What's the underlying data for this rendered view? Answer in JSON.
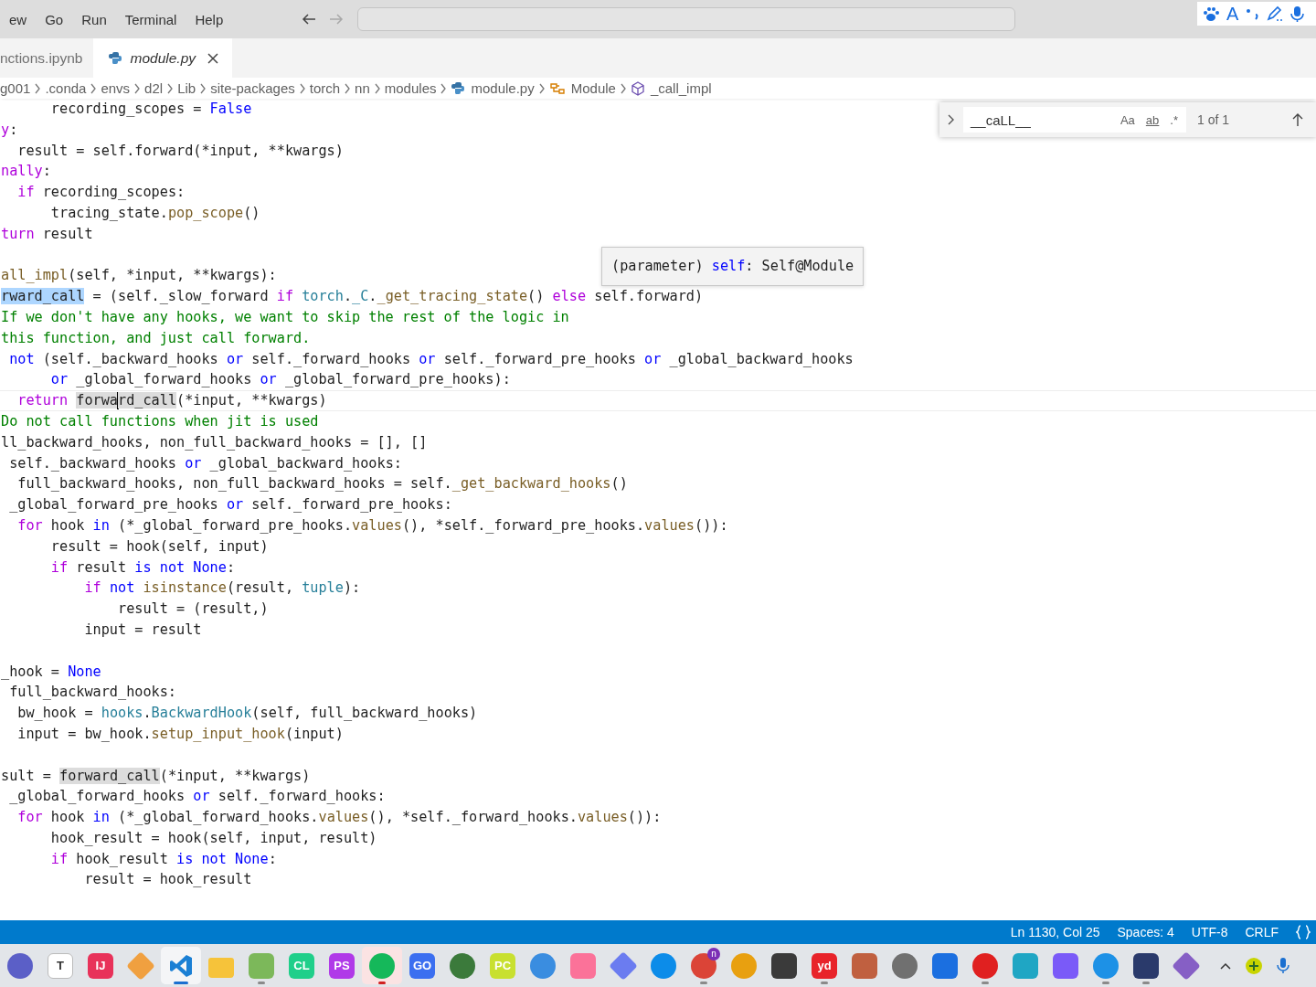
{
  "menu": [
    "ew",
    "Go",
    "Run",
    "Terminal",
    "Help"
  ],
  "navigation": {
    "back_disabled": false,
    "forward_disabled": true
  },
  "ime_toolbar": {
    "mode": "A"
  },
  "tabs": [
    {
      "label": "nctions.ipynb",
      "selected": false,
      "preview": false
    },
    {
      "label": "module.py",
      "selected": true,
      "preview": true
    }
  ],
  "breadcrumbs": [
    {
      "label": "g001",
      "kind": "folder"
    },
    {
      "label": ".conda",
      "kind": "folder"
    },
    {
      "label": "envs",
      "kind": "folder"
    },
    {
      "label": "d2l",
      "kind": "folder"
    },
    {
      "label": "Lib",
      "kind": "folder"
    },
    {
      "label": "site-packages",
      "kind": "folder"
    },
    {
      "label": "torch",
      "kind": "folder"
    },
    {
      "label": "nn",
      "kind": "folder"
    },
    {
      "label": "modules",
      "kind": "folder"
    },
    {
      "label": "module.py",
      "kind": "file"
    },
    {
      "label": "Module",
      "kind": "class"
    },
    {
      "label": "_call_impl",
      "kind": "method"
    }
  ],
  "editor": {
    "lines": [
      {
        "kind": "code",
        "current": false,
        "segments": [
          {
            "kind": "plain",
            "text": "      recording_scopes = "
          },
          {
            "kind": "operator",
            "text": "False"
          }
        ]
      },
      {
        "kind": "code",
        "current": false,
        "segments": [
          {
            "kind": "keyword",
            "text": "y"
          },
          {
            "kind": "plain",
            "text": ":"
          }
        ]
      },
      {
        "kind": "code",
        "current": false,
        "segments": [
          {
            "kind": "plain",
            "text": "  result = self.forward(*input, **kwargs)"
          }
        ]
      },
      {
        "kind": "code",
        "current": false,
        "segments": [
          {
            "kind": "keyword",
            "text": "nally"
          },
          {
            "kind": "plain",
            "text": ":"
          }
        ]
      },
      {
        "kind": "code",
        "current": false,
        "segments": [
          {
            "kind": "keyword",
            "text": "  if"
          },
          {
            "kind": "plain",
            "text": " recording_scopes:"
          }
        ]
      },
      {
        "kind": "code",
        "current": false,
        "segments": [
          {
            "kind": "plain",
            "text": "      tracing_state."
          },
          {
            "kind": "function",
            "text": "pop_scope"
          },
          {
            "kind": "plain",
            "text": "()"
          }
        ]
      },
      {
        "kind": "code",
        "current": false,
        "segments": [
          {
            "kind": "keyword",
            "text": "turn"
          },
          {
            "kind": "plain",
            "text": " result"
          }
        ]
      },
      {
        "kind": "blank"
      },
      {
        "kind": "code",
        "current": false,
        "segments": [
          {
            "kind": "function",
            "text": "all_impl"
          },
          {
            "kind": "plain",
            "text": "(self, *input, **kwargs):"
          }
        ]
      },
      {
        "kind": "code",
        "current": false,
        "segments": [
          {
            "kind": "selection",
            "text": "rward_call"
          },
          {
            "kind": "plain",
            "text": " = (self._slow_forward "
          },
          {
            "kind": "keyword",
            "text": "if "
          },
          {
            "kind": "type",
            "text": "torch"
          },
          {
            "kind": "plain",
            "text": "."
          },
          {
            "kind": "type",
            "text": "_C"
          },
          {
            "kind": "plain",
            "text": "."
          },
          {
            "kind": "function",
            "text": "_get_tracing_state"
          },
          {
            "kind": "plain",
            "text": "() "
          },
          {
            "kind": "keyword",
            "text": "else"
          },
          {
            "kind": "plain",
            "text": " self.forward)"
          }
        ]
      },
      {
        "kind": "code",
        "current": false,
        "segments": [
          {
            "kind": "comment",
            "text": "If we don't have any hooks, we want to skip the rest of the logic in"
          }
        ]
      },
      {
        "kind": "code",
        "current": false,
        "segments": [
          {
            "kind": "comment",
            "text": "this function, and just call forward."
          }
        ]
      },
      {
        "kind": "code",
        "current": false,
        "segments": [
          {
            "kind": "operator",
            "text": " not"
          },
          {
            "kind": "plain",
            "text": " (self._backward_hooks "
          },
          {
            "kind": "operator",
            "text": "or"
          },
          {
            "kind": "plain",
            "text": " self._forward_hooks "
          },
          {
            "kind": "operator",
            "text": "or"
          },
          {
            "kind": "plain",
            "text": " self._forward_pre_hooks "
          },
          {
            "kind": "operator",
            "text": "or"
          },
          {
            "kind": "plain",
            "text": " _global_backward_hooks"
          }
        ]
      },
      {
        "kind": "code",
        "current": false,
        "segments": [
          {
            "kind": "operator",
            "text": "      or"
          },
          {
            "kind": "plain",
            "text": " _global_forward_hooks "
          },
          {
            "kind": "operator",
            "text": "or"
          },
          {
            "kind": "plain",
            "text": " _global_forward_pre_hooks):"
          }
        ]
      },
      {
        "kind": "code",
        "current": true,
        "segments": [
          {
            "kind": "keyword",
            "text": "  return "
          },
          {
            "kind": "match",
            "text": "forwa"
          },
          {
            "kind": "caret"
          },
          {
            "kind": "match",
            "text": "rd_call"
          },
          {
            "kind": "plain",
            "text": "(*input, **kwargs)"
          }
        ]
      },
      {
        "kind": "code",
        "current": false,
        "segments": [
          {
            "kind": "comment",
            "text": "Do not call functions when jit is used"
          }
        ]
      },
      {
        "kind": "code",
        "current": false,
        "segments": [
          {
            "kind": "plain",
            "text": "ll_backward_hooks, non_full_backward_hooks = [], []"
          }
        ]
      },
      {
        "kind": "code",
        "current": false,
        "segments": [
          {
            "kind": "plain",
            "text": " self._backward_hooks "
          },
          {
            "kind": "operator",
            "text": "or"
          },
          {
            "kind": "plain",
            "text": " _global_backward_hooks:"
          }
        ]
      },
      {
        "kind": "code",
        "current": false,
        "segments": [
          {
            "kind": "plain",
            "text": "  full_backward_hooks, non_full_backward_hooks = self."
          },
          {
            "kind": "function",
            "text": "_get_backward_hooks"
          },
          {
            "kind": "plain",
            "text": "()"
          }
        ]
      },
      {
        "kind": "code",
        "current": false,
        "segments": [
          {
            "kind": "plain",
            "text": " _global_forward_pre_hooks "
          },
          {
            "kind": "operator",
            "text": "or"
          },
          {
            "kind": "plain",
            "text": " self._forward_pre_hooks:"
          }
        ]
      },
      {
        "kind": "code",
        "current": false,
        "segments": [
          {
            "kind": "keyword",
            "text": "  for"
          },
          {
            "kind": "plain",
            "text": " hook "
          },
          {
            "kind": "operator",
            "text": "in"
          },
          {
            "kind": "plain",
            "text": " (*_global_forward_pre_hooks."
          },
          {
            "kind": "function",
            "text": "values"
          },
          {
            "kind": "plain",
            "text": "(), *self._forward_pre_hooks."
          },
          {
            "kind": "function",
            "text": "values"
          },
          {
            "kind": "plain",
            "text": "()):"
          }
        ]
      },
      {
        "kind": "code",
        "current": false,
        "segments": [
          {
            "kind": "plain",
            "text": "      result = hook(self, input)"
          }
        ]
      },
      {
        "kind": "code",
        "current": false,
        "segments": [
          {
            "kind": "keyword",
            "text": "      if"
          },
          {
            "kind": "plain",
            "text": " result "
          },
          {
            "kind": "operator",
            "text": "is not None"
          },
          {
            "kind": "plain",
            "text": ":"
          }
        ]
      },
      {
        "kind": "code",
        "current": false,
        "segments": [
          {
            "kind": "keyword",
            "text": "          if "
          },
          {
            "kind": "operator",
            "text": "not "
          },
          {
            "kind": "function",
            "text": "isinstance"
          },
          {
            "kind": "plain",
            "text": "(result, "
          },
          {
            "kind": "type",
            "text": "tuple"
          },
          {
            "kind": "plain",
            "text": "):"
          }
        ]
      },
      {
        "kind": "code",
        "current": false,
        "segments": [
          {
            "kind": "plain",
            "text": "              result = (result,)"
          }
        ]
      },
      {
        "kind": "code",
        "current": false,
        "segments": [
          {
            "kind": "plain",
            "text": "          input = result"
          }
        ]
      },
      {
        "kind": "blank"
      },
      {
        "kind": "code",
        "current": false,
        "segments": [
          {
            "kind": "plain",
            "text": "_hook = "
          },
          {
            "kind": "operator",
            "text": "None"
          }
        ]
      },
      {
        "kind": "code",
        "current": false,
        "segments": [
          {
            "kind": "plain",
            "text": " full_backward_hooks:"
          }
        ]
      },
      {
        "kind": "code",
        "current": false,
        "segments": [
          {
            "kind": "plain",
            "text": "  bw_hook = "
          },
          {
            "kind": "type",
            "text": "hooks"
          },
          {
            "kind": "plain",
            "text": "."
          },
          {
            "kind": "type",
            "text": "BackwardHook"
          },
          {
            "kind": "plain",
            "text": "(self, full_backward_hooks)"
          }
        ]
      },
      {
        "kind": "code",
        "current": false,
        "segments": [
          {
            "kind": "plain",
            "text": "  input = bw_hook."
          },
          {
            "kind": "function",
            "text": "setup_input_hook"
          },
          {
            "kind": "plain",
            "text": "(input)"
          }
        ]
      },
      {
        "kind": "blank"
      },
      {
        "kind": "code",
        "current": false,
        "segments": [
          {
            "kind": "plain",
            "text": "sult = "
          },
          {
            "kind": "match",
            "text": "forward_call"
          },
          {
            "kind": "plain",
            "text": "(*input, **kwargs)"
          }
        ]
      },
      {
        "kind": "code",
        "current": false,
        "segments": [
          {
            "kind": "plain",
            "text": " _global_forward_hooks "
          },
          {
            "kind": "operator",
            "text": "or"
          },
          {
            "kind": "plain",
            "text": " self._forward_hooks:"
          }
        ]
      },
      {
        "kind": "code",
        "current": false,
        "segments": [
          {
            "kind": "keyword",
            "text": "  for"
          },
          {
            "kind": "plain",
            "text": " hook "
          },
          {
            "kind": "operator",
            "text": "in"
          },
          {
            "kind": "plain",
            "text": " (*_global_forward_hooks."
          },
          {
            "kind": "function",
            "text": "values"
          },
          {
            "kind": "plain",
            "text": "(), *self._forward_hooks."
          },
          {
            "kind": "function",
            "text": "values"
          },
          {
            "kind": "plain",
            "text": "()):"
          }
        ]
      },
      {
        "kind": "code",
        "current": false,
        "segments": [
          {
            "kind": "plain",
            "text": "      hook_result = hook(self, input, result)"
          }
        ]
      },
      {
        "kind": "code",
        "current": false,
        "segments": [
          {
            "kind": "keyword",
            "text": "      if"
          },
          {
            "kind": "plain",
            "text": " hook_result "
          },
          {
            "kind": "operator",
            "text": "is not None"
          },
          {
            "kind": "plain",
            "text": ":"
          }
        ]
      },
      {
        "kind": "code",
        "current": false,
        "segments": [
          {
            "kind": "plain",
            "text": "          result = hook_result"
          }
        ]
      }
    ]
  },
  "hover": {
    "segments": [
      {
        "kind": "plain",
        "text": "(parameter) "
      },
      {
        "kind": "operator",
        "text": "self"
      },
      {
        "kind": "plain",
        "text": ": Self@Module"
      }
    ]
  },
  "find": {
    "expanded": false,
    "query": "__caLL__",
    "options": [
      {
        "label": "Aa",
        "selected": false
      },
      {
        "label": "ab",
        "selected": false
      },
      {
        "label": ".*",
        "selected": false
      }
    ],
    "result": "1 of 1"
  },
  "status_bar": {
    "items": [
      "Ln 1130, Col 25",
      "Spaces: 4",
      "UTF-8",
      "CRLF"
    ]
  },
  "taskbar": {
    "apps": [
      {
        "kind": "circle",
        "color": "#5b5fc7",
        "running": false,
        "active": false,
        "attention": false
      },
      {
        "kind": "tile",
        "color": "#ffffff",
        "label": "T",
        "running": false,
        "active": false,
        "attention": false
      },
      {
        "kind": "tile",
        "color": "#e8325a",
        "label": "IJ",
        "running": false,
        "active": false,
        "attention": false
      },
      {
        "kind": "diamond",
        "color": "#f0a040",
        "running": false,
        "active": false,
        "attention": false
      },
      {
        "kind": "vscode",
        "color": "#1a7fd4",
        "running": true,
        "active": true,
        "attention": false
      },
      {
        "kind": "folder",
        "color": "#f6c33a",
        "running": false,
        "active": false,
        "attention": false
      },
      {
        "kind": "tile",
        "color": "#7cb85a",
        "running": true,
        "active": false,
        "attention": false
      },
      {
        "kind": "tile",
        "color": "#1fcf8a",
        "label": "CL",
        "running": false,
        "active": false,
        "attention": false
      },
      {
        "kind": "tile",
        "color": "#b03ae8",
        "label": "PS",
        "running": false,
        "active": false,
        "attention": false
      },
      {
        "kind": "circle",
        "color": "#15b85a",
        "running": true,
        "active": false,
        "attention": true
      },
      {
        "kind": "tile",
        "color": "#3b6ff0",
        "label": "GO",
        "running": false,
        "active": false,
        "attention": false
      },
      {
        "kind": "circle",
        "color": "#3b7a3b",
        "running": false,
        "active": false,
        "attention": false
      },
      {
        "kind": "tile",
        "color": "#c8e030",
        "label": "PC",
        "running": false,
        "active": false,
        "attention": false
      },
      {
        "kind": "circle",
        "color": "#3a8de0",
        "running": false,
        "active": false,
        "attention": false
      },
      {
        "kind": "tile",
        "color": "#fb7299",
        "running": false,
        "active": false,
        "attention": false
      },
      {
        "kind": "diamond",
        "color": "#6b7cf0",
        "running": false,
        "active": false,
        "attention": false
      },
      {
        "kind": "circle",
        "color": "#0c8ce9",
        "running": false,
        "active": false,
        "attention": false
      },
      {
        "kind": "circle",
        "color": "#db4437",
        "badge": "n",
        "running": true,
        "active": false,
        "attention": false
      },
      {
        "kind": "circle",
        "color": "#e8a010",
        "running": false,
        "active": false,
        "attention": false
      },
      {
        "kind": "tile",
        "color": "#3a3a3a",
        "running": false,
        "active": false,
        "attention": false
      },
      {
        "kind": "tile",
        "color": "#e8232a",
        "label": "yd",
        "running": true,
        "active": false,
        "attention": false
      },
      {
        "kind": "tile",
        "color": "#c06040",
        "running": false,
        "active": false,
        "attention": false
      },
      {
        "kind": "circle",
        "color": "#707070",
        "running": false,
        "active": false,
        "attention": false
      },
      {
        "kind": "tile",
        "color": "#1b6fe0",
        "running": false,
        "active": false,
        "attention": false
      },
      {
        "kind": "circle",
        "color": "#e02020",
        "running": true,
        "active": false,
        "attention": false
      },
      {
        "kind": "tile",
        "color": "#1fa6c4",
        "running": false,
        "active": false,
        "attention": false
      },
      {
        "kind": "tile",
        "color": "#7a5af8",
        "running": false,
        "active": false,
        "attention": false
      },
      {
        "kind": "circle",
        "color": "#1d91e6",
        "running": true,
        "active": false,
        "attention": false
      },
      {
        "kind": "tile",
        "color": "#2a3a6b",
        "running": true,
        "active": false,
        "attention": false
      },
      {
        "kind": "diamond",
        "color": "#865fc5",
        "running": false,
        "active": false,
        "attention": false
      }
    ]
  }
}
